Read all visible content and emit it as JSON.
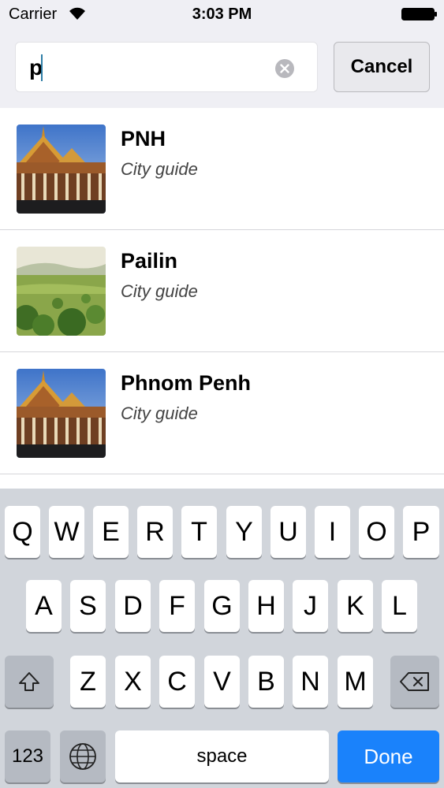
{
  "status_bar": {
    "carrier": "Carrier",
    "time": "3:03 PM",
    "wifi_icon": "wifi-icon",
    "battery_icon": "battery-icon"
  },
  "search": {
    "value": "p",
    "clear_icon": "clear-icon",
    "cancel_label": "Cancel"
  },
  "results": [
    {
      "title": "PNH",
      "subtitle": "City guide",
      "image": "temple-thumbnail"
    },
    {
      "title": "Pailin",
      "subtitle": "City guide",
      "image": "landscape-thumbnail"
    },
    {
      "title": "Phnom Penh",
      "subtitle": "City guide",
      "image": "temple-thumbnail"
    }
  ],
  "keyboard": {
    "row1": [
      "Q",
      "W",
      "E",
      "R",
      "T",
      "Y",
      "U",
      "I",
      "O",
      "P"
    ],
    "row2": [
      "A",
      "S",
      "D",
      "F",
      "G",
      "H",
      "J",
      "K",
      "L"
    ],
    "row3": [
      "Z",
      "X",
      "C",
      "V",
      "B",
      "N",
      "M"
    ],
    "shift_icon": "shift-icon",
    "delete_icon": "delete-icon",
    "numbers_label": "123",
    "globe_icon": "globe-icon",
    "space_label": "space",
    "done_label": "Done",
    "accent_color": "#1a82fb"
  }
}
